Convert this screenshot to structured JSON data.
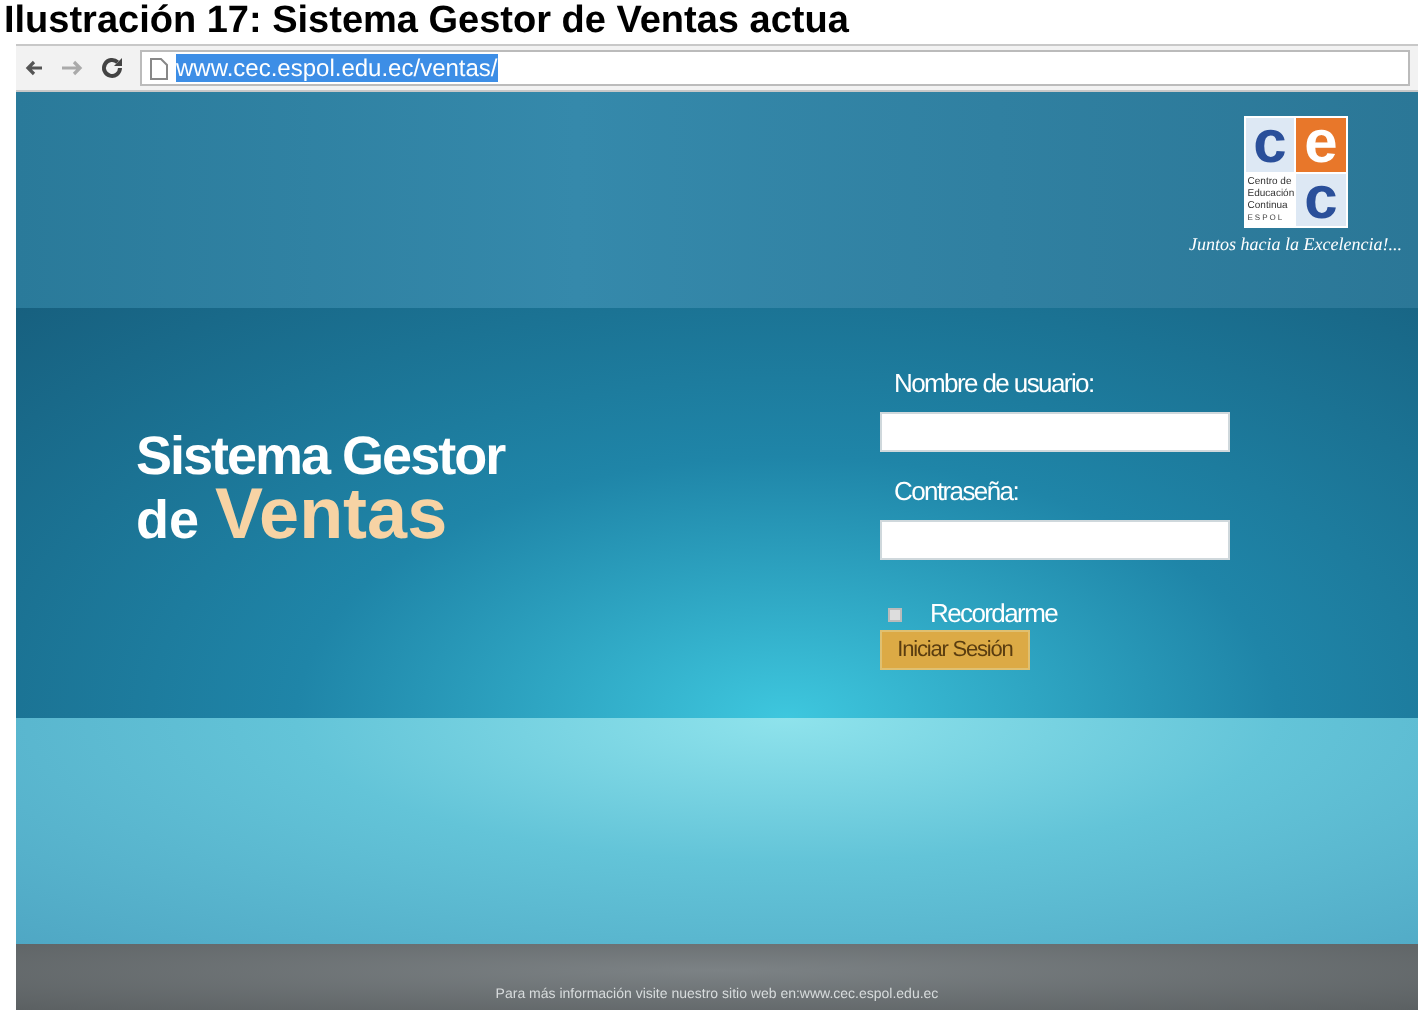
{
  "caption": "Ilustración 17: Sistema Gestor de Ventas actua",
  "browser": {
    "url": "www.cec.espol.edu.ec/ventas/"
  },
  "logo": {
    "letters": [
      "c",
      "e",
      "c"
    ],
    "lines": [
      "Centro de",
      "Educación",
      "Continua",
      "ESPOL"
    ],
    "slogan": "Juntos hacia la Excelencia!..."
  },
  "title": {
    "line_1": "Sistema Gestor",
    "line_2_prefix": "de",
    "line_2_emphasis": "Ventas"
  },
  "login": {
    "fields": [
      {
        "label": "Nombre de usuario:"
      },
      {
        "label": "Contraseña:"
      }
    ],
    "remember": {
      "label": "Recordarme",
      "checked": false
    },
    "submit": "Iniciar Sesión"
  },
  "footer": "Para más información visite nuestro sitio web en:www.cec.espol.edu.ec"
}
